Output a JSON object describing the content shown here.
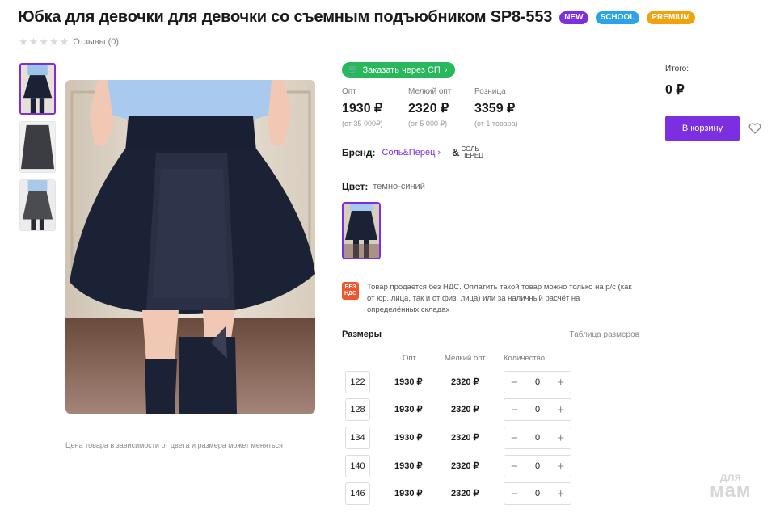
{
  "product": {
    "title": "Юбка для девочки для девочки со съемным подъюбником SP8-553",
    "badges": {
      "new": "NEW",
      "school": "SCHOOL",
      "premium": "PREMIUM"
    },
    "rating": {
      "stars": 0,
      "max": 5,
      "reviews_label": "Отзывы (0)"
    },
    "price_note": "Цена товара в зависимости от цвета и размера может меняться"
  },
  "order": {
    "sp_button_label": "Заказать через СП"
  },
  "prices": [
    {
      "label": "Опт",
      "value": "1930 ₽",
      "sub": "(от 35 000₽)"
    },
    {
      "label": "Мелкий опт",
      "value": "2320 ₽",
      "sub": "(от 5 000 ₽)"
    },
    {
      "label": "Розница",
      "value": "3359 ₽",
      "sub": "(от 1 товара)"
    }
  ],
  "brand": {
    "label": "Бренд:",
    "name": "Соль&Перец",
    "logo_line1": "СОЛЬ",
    "logo_line2": "ПЕРЕЦ"
  },
  "color": {
    "label": "Цвет:",
    "value": "темно-синий"
  },
  "vat": {
    "badge_line1": "БЕЗ",
    "badge_line2": "НДС",
    "text": "Товар продается без НДС. Оплатить такой товар можно только на р/с (как от юр. лица, так и от физ. лица) или за наличный расчёт на определённых складах"
  },
  "sizes": {
    "title": "Размеры",
    "table_link": "Таблица размеров",
    "columns": {
      "opt": "Опт",
      "small_opt": "Мелкий опт",
      "qty": "Количество"
    },
    "rows": [
      {
        "size": "122",
        "opt": "1930 ₽",
        "small_opt": "2320 ₽",
        "qty": "0"
      },
      {
        "size": "128",
        "opt": "1930 ₽",
        "small_opt": "2320 ₽",
        "qty": "0"
      },
      {
        "size": "134",
        "opt": "1930 ₽",
        "small_opt": "2320 ₽",
        "qty": "0"
      },
      {
        "size": "140",
        "opt": "1930 ₽",
        "small_opt": "2320 ₽",
        "qty": "0"
      },
      {
        "size": "146",
        "opt": "1930 ₽",
        "small_opt": "2320 ₽",
        "qty": "0"
      }
    ],
    "minus": "−",
    "plus": "+"
  },
  "total": {
    "label": "Итого:",
    "value": "0 ₽"
  },
  "cart": {
    "button_label": "В корзину"
  },
  "watermark": {
    "line1": "для",
    "line2": "мам"
  },
  "icons": {
    "favorite": "heart-icon",
    "cart": "cart-icon",
    "chevron": "chevron-right-icon",
    "star": "star-icon"
  },
  "colors": {
    "accent": "#7b2fe0",
    "green": "#26b85a",
    "new": "#7b2fe0",
    "school": "#2aa3e8",
    "premium": "#f2a20c",
    "vat": "#f0562c",
    "skirt": "#1c2236"
  }
}
